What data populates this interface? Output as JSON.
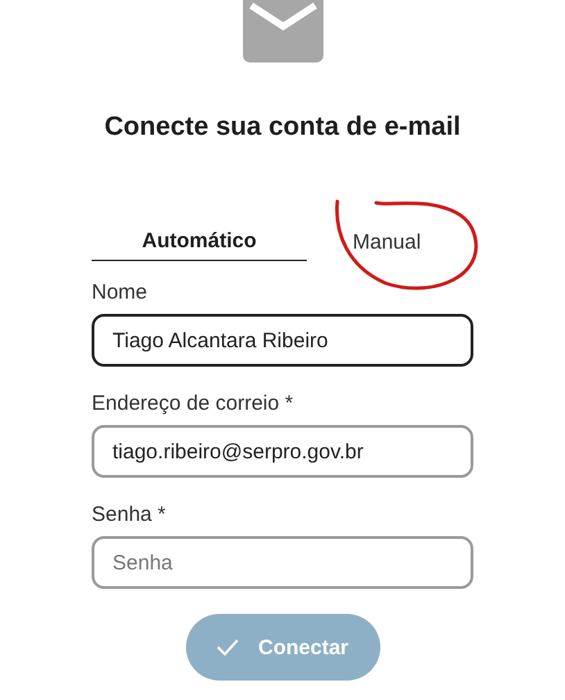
{
  "title": "Conecte sua conta de e-mail",
  "tabs": [
    {
      "label": "Automático",
      "selected": true
    },
    {
      "label": "Manual",
      "selected": false
    }
  ],
  "fields": [
    {
      "label": "Nome",
      "value": "Tiago Alcantara Ribeiro",
      "focused": true
    },
    {
      "label": "Endereço de correio *",
      "value": "tiago.ribeiro@serpro.gov.br",
      "focused": false
    },
    {
      "label": "Senha *",
      "placeholder": "Senha",
      "focused": false
    }
  ],
  "button": {
    "label": "Conectar",
    "disabled": true
  }
}
